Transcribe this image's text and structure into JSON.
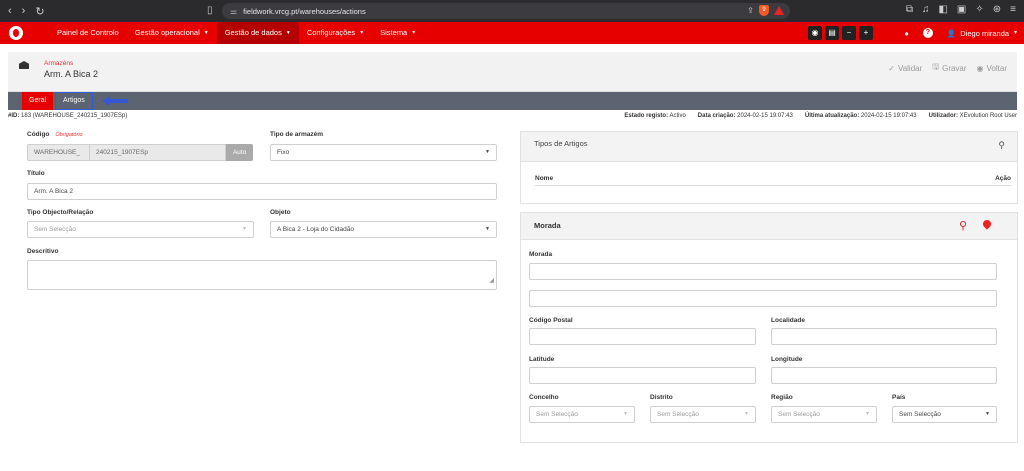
{
  "browser": {
    "url": "fieldwork.vrcg.pt/warehouses/actions"
  },
  "nav": {
    "items": [
      {
        "label": "Painel de Controlo",
        "caret": false
      },
      {
        "label": "Gestão operacional",
        "caret": true
      },
      {
        "label": "Gestão de dados",
        "caret": true,
        "active": true
      },
      {
        "label": "Configurações",
        "caret": true
      },
      {
        "label": "Sistema",
        "caret": true
      }
    ],
    "user": "Diego miranda"
  },
  "header": {
    "breadcrumb": "Armazéns",
    "title": "Arm. A Bica 2",
    "actions": {
      "validar": "Validar",
      "gravar": "Gravar",
      "voltar": "Voltar"
    }
  },
  "tabs": {
    "geral": "Geral",
    "artigos": "Artigos"
  },
  "status": {
    "id_label": "#ID:",
    "id_value": "183 (WAREHOUSE_240215_1907ESp)",
    "estado_label": "Estado registo:",
    "estado_value": "Activo",
    "criacao_label": "Data criação:",
    "criacao_value": "2024-02-15 19:07:43",
    "atualizacao_label": "Última atualização:",
    "atualizacao_value": "2024-02-15 19:07:43",
    "utilizador_label": "Utilizador:",
    "utilizador_value": "XEvolution Root User"
  },
  "form": {
    "codigo_label": "Código",
    "codigo_required": "Obrigatório",
    "codigo_prefix": "WAREHOUSE_",
    "codigo_value": "240215_1907ESp",
    "auto_label": "Auto",
    "tipo_armazem_label": "Tipo de armazém",
    "tipo_armazem_value": "Fixo",
    "titulo_label": "Título",
    "titulo_value": "Arm. A Bica 2",
    "tipo_objecto_label": "Tipo Objecto/Relação",
    "tipo_objecto_value": "Sem Selecção",
    "objeto_label": "Objeto",
    "objeto_value": "A Bica 2 - Loja do Cidadão",
    "descritivo_label": "Descritivo"
  },
  "tipos_artigos": {
    "title": "Tipos de Artigos",
    "col_nome": "Nome",
    "col_acao": "Ação"
  },
  "morada": {
    "title": "Morada",
    "morada_label": "Morada",
    "codigo_postal_label": "Código Postal",
    "localidade_label": "Localidade",
    "latitude_label": "Latitude",
    "longitude_label": "Longitude",
    "concelho_label": "Concelho",
    "distrito_label": "Distrito",
    "regiao_label": "Região",
    "pais_label": "País",
    "concelho_value": "Sem Selecção",
    "distrito_value": "Sem Selecção",
    "regiao_value": "Sem Selecção",
    "pais_value": "Sem Selecção"
  },
  "colors": {
    "brand": "#e60000",
    "tabbar": "#5b6470",
    "highlight": "#2f5bd6"
  }
}
